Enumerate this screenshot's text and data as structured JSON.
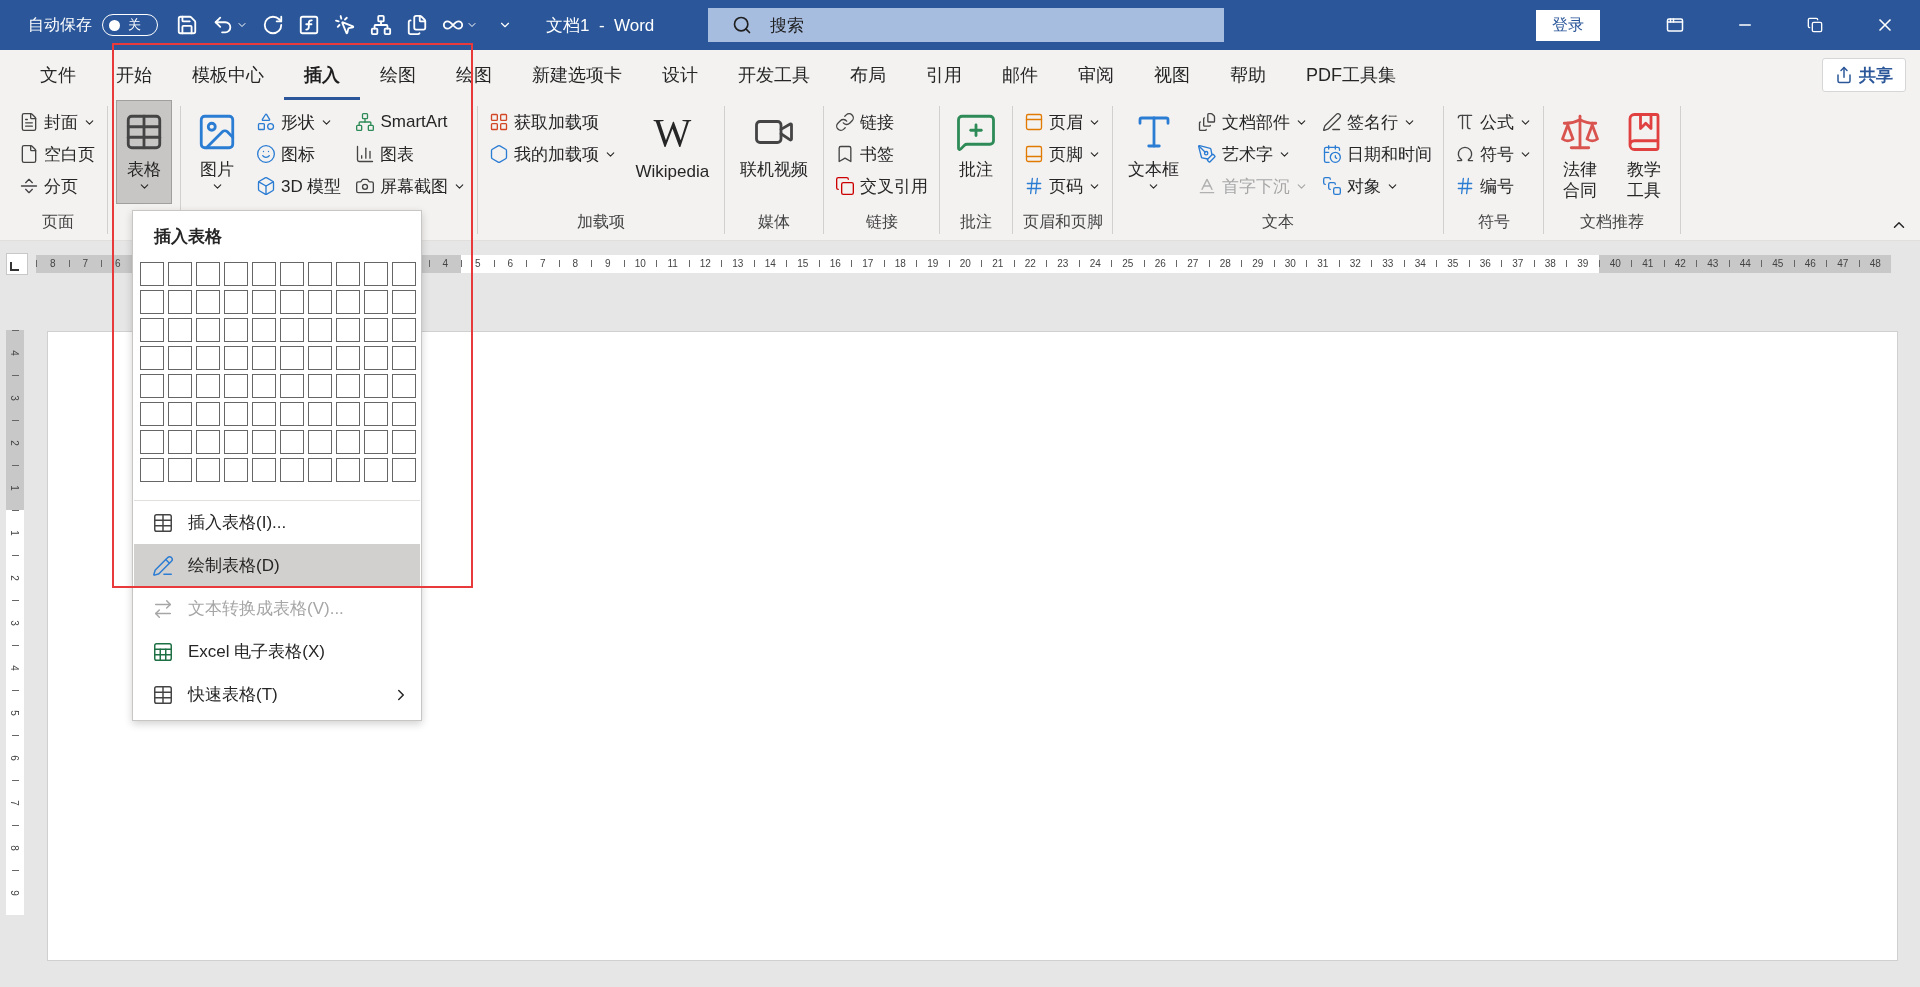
{
  "title_bar": {
    "autosave": {
      "label": "自动保存",
      "on": false,
      "state_text": "关"
    },
    "document_title": "文档1  -  Word",
    "search": {
      "placeholder": "搜索"
    },
    "login_button": "登录"
  },
  "tabs": [
    {
      "label": "文件",
      "selected": false
    },
    {
      "label": "开始",
      "selected": false
    },
    {
      "label": "模板中心",
      "selected": false
    },
    {
      "label": "插入",
      "selected": true
    },
    {
      "label": "绘图",
      "selected": false
    },
    {
      "label": "绘图",
      "selected": false
    },
    {
      "label": "新建选项卡",
      "selected": false
    },
    {
      "label": "设计",
      "selected": false
    },
    {
      "label": "开发工具",
      "selected": false
    },
    {
      "label": "布局",
      "selected": false
    },
    {
      "label": "引用",
      "selected": false
    },
    {
      "label": "邮件",
      "selected": false
    },
    {
      "label": "审阅",
      "selected": false
    },
    {
      "label": "视图",
      "selected": false
    },
    {
      "label": "帮助",
      "selected": false
    },
    {
      "label": "PDF工具集",
      "selected": false
    }
  ],
  "share_button": "共享",
  "ribbon_groups": [
    {
      "label": "页面",
      "columns": [
        {
          "kind": "stack",
          "items": [
            {
              "label": "封面",
              "dropdown": true,
              "disabled": false
            },
            {
              "label": "空白页",
              "dropdown": false,
              "disabled": false
            },
            {
              "label": "分页",
              "dropdown": false,
              "disabled": false
            }
          ]
        }
      ]
    },
    {
      "columns": [
        {
          "kind": "large",
          "items": [
            {
              "label": "表格",
              "dropdown": true,
              "disabled": false,
              "pressed": true
            }
          ]
        }
      ]
    },
    {
      "columns": [
        {
          "kind": "large",
          "items": [
            {
              "label": "图片",
              "dropdown": true,
              "disabled": false,
              "pressed": false
            }
          ]
        },
        {
          "kind": "stack",
          "items": [
            {
              "label": "形状",
              "dropdown": true,
              "disabled": false
            },
            {
              "label": "图标",
              "dropdown": false,
              "disabled": false
            },
            {
              "label": "3D 模型",
              "dropdown": false,
              "disabled": false
            }
          ]
        },
        {
          "kind": "stack",
          "items": [
            {
              "label": "SmartArt",
              "dropdown": false,
              "disabled": false
            },
            {
              "label": "图表",
              "dropdown": false,
              "disabled": false
            },
            {
              "label": "屏幕截图",
              "dropdown": true,
              "disabled": false
            }
          ]
        }
      ]
    },
    {
      "label": "加载项",
      "columns": [
        {
          "kind": "stack",
          "items": [
            {
              "label": "获取加载项",
              "dropdown": false,
              "disabled": false
            },
            {
              "label": "我的加载项",
              "dropdown": true,
              "disabled": false
            }
          ]
        },
        {
          "kind": "large",
          "items": [
            {
              "label": "Wikipedia",
              "glyph": "W",
              "dropdown": false,
              "disabled": false,
              "pressed": false
            }
          ]
        }
      ]
    },
    {
      "label": "媒体",
      "columns": [
        {
          "kind": "large",
          "items": [
            {
              "label": "联机视频",
              "dropdown": false,
              "disabled": false,
              "pressed": false
            }
          ]
        }
      ]
    },
    {
      "label": "链接",
      "columns": [
        {
          "kind": "stack",
          "items": [
            {
              "label": "链接",
              "dropdown": false,
              "disabled": false
            },
            {
              "label": "书签",
              "dropdown": false,
              "disabled": false
            },
            {
              "label": "交叉引用",
              "dropdown": false,
              "disabled": false
            }
          ]
        }
      ]
    },
    {
      "label": "批注",
      "columns": [
        {
          "kind": "large",
          "items": [
            {
              "label": "批注",
              "dropdown": false,
              "disabled": false,
              "pressed": false
            }
          ]
        }
      ]
    },
    {
      "label": "页眉和页脚",
      "columns": [
        {
          "kind": "stack",
          "items": [
            {
              "label": "页眉",
              "dropdown": true,
              "disabled": false
            },
            {
              "label": "页脚",
              "dropdown": true,
              "disabled": false
            },
            {
              "label": "页码",
              "dropdown": true,
              "disabled": false
            }
          ]
        }
      ]
    },
    {
      "label": "文本",
      "columns": [
        {
          "kind": "large",
          "items": [
            {
              "label": "文本框",
              "dropdown": true,
              "disabled": false,
              "pressed": false
            }
          ]
        },
        {
          "kind": "stack",
          "items": [
            {
              "label": "文档部件",
              "dropdown": true,
              "disabled": false
            },
            {
              "label": "艺术字",
              "dropdown": true,
              "disabled": false
            },
            {
              "label": "首字下沉",
              "dropdown": true,
              "disabled": true
            }
          ]
        },
        {
          "kind": "stack",
          "items": [
            {
              "label": "签名行",
              "dropdown": true,
              "disabled": false
            },
            {
              "label": "日期和时间",
              "dropdown": false,
              "disabled": false
            },
            {
              "label": "对象",
              "dropdown": true,
              "disabled": false
            }
          ]
        }
      ]
    },
    {
      "label": "符号",
      "columns": [
        {
          "kind": "stack",
          "items": [
            {
              "label": "公式",
              "dropdown": true,
              "disabled": false
            },
            {
              "label": "符号",
              "dropdown": true,
              "disabled": false
            },
            {
              "label": "编号",
              "dropdown": false,
              "disabled": false
            }
          ]
        }
      ]
    },
    {
      "label": "文档推荐",
      "columns": [
        {
          "kind": "large",
          "items": [
            {
              "label": "法律合同",
              "dropdown": false,
              "disabled": false,
              "pressed": false
            }
          ]
        },
        {
          "kind": "large",
          "items": [
            {
              "label": "教学工具",
              "dropdown": false,
              "disabled": false,
              "pressed": false
            }
          ]
        }
      ]
    }
  ],
  "ruler": {
    "segments": [
      {
        "kind": "margin",
        "labels": [
          "8",
          "7",
          "6"
        ]
      },
      {
        "kind": "margin",
        "labels": [
          "4"
        ]
      },
      {
        "kind": "text",
        "labels": [
          "5",
          "6",
          "7",
          "8",
          "9",
          "10",
          "11",
          "12",
          "13",
          "14",
          "15",
          "16",
          "17",
          "18",
          "19",
          "20",
          "21",
          "22",
          "23",
          "24",
          "25",
          "26",
          "27",
          "28",
          "29",
          "30",
          "31",
          "32",
          "33",
          "34",
          "35",
          "36",
          "37",
          "38",
          "39"
        ]
      },
      {
        "kind": "margin",
        "labels": [
          "40",
          "41",
          "42",
          "43",
          "44",
          "45",
          "46",
          "47",
          "48"
        ]
      }
    ]
  },
  "vertical_ruler": {
    "segments": [
      {
        "kind": "margin",
        "labels": [
          "4",
          "3",
          "2",
          "1"
        ]
      },
      {
        "kind": "text",
        "labels": [
          "1",
          "2",
          "3",
          "4",
          "5",
          "6",
          "7",
          "8",
          "9"
        ]
      }
    ]
  },
  "table_menu": {
    "title": "插入表格",
    "items": [
      {
        "label": "插入表格(I)...",
        "selected": false,
        "disabled": false,
        "submenu": false
      },
      {
        "label": "绘制表格(D)",
        "selected": true,
        "disabled": false,
        "submenu": false
      },
      {
        "label": "文本转换成表格(V)...",
        "selected": false,
        "disabled": true,
        "submenu": false
      },
      {
        "label": "Excel 电子表格(X)",
        "selected": false,
        "disabled": false,
        "submenu": false
      },
      {
        "label": "快速表格(T)",
        "selected": false,
        "disabled": false,
        "submenu": true
      }
    ]
  }
}
